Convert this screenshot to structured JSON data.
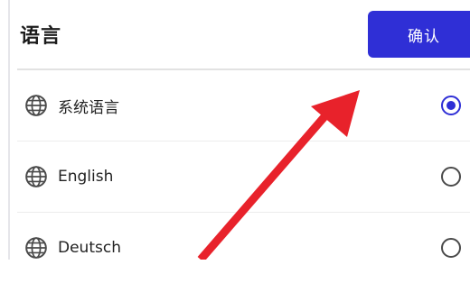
{
  "header": {
    "title": "语言",
    "confirm_label": "确认"
  },
  "languages": [
    {
      "label": "系统语言",
      "selected": true
    },
    {
      "label": "English",
      "selected": false
    },
    {
      "label": "Deutsch",
      "selected": false
    }
  ],
  "colors": {
    "accent": "#2f2fd6",
    "annotation_arrow": "#e8222b"
  }
}
